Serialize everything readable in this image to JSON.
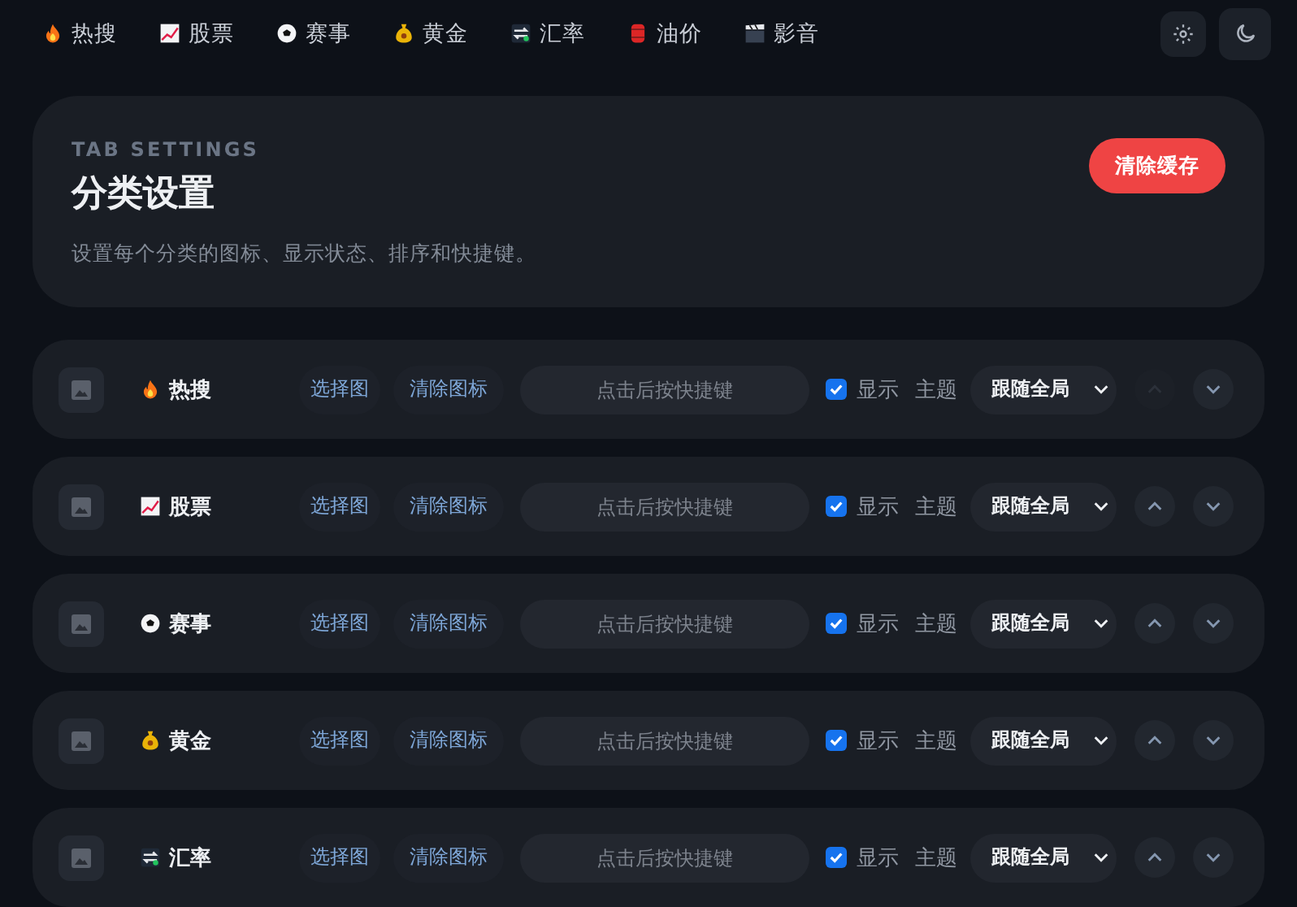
{
  "nav": {
    "tabs": [
      {
        "label": "热搜",
        "kind": "fire"
      },
      {
        "label": "股票",
        "kind": "chart"
      },
      {
        "label": "赛事",
        "kind": "ball"
      },
      {
        "label": "黄金",
        "kind": "money"
      },
      {
        "label": "汇率",
        "kind": "exchange"
      },
      {
        "label": "油价",
        "kind": "barrel"
      },
      {
        "label": "影音",
        "kind": "clapper"
      }
    ]
  },
  "header": {
    "eyebrow": "TAB SETTINGS",
    "title": "分类设置",
    "description": "设置每个分类的图标、显示状态、排序和快捷键。",
    "clear_button": "清除缓存"
  },
  "rows": [
    {
      "label": "热搜",
      "kind": "fire",
      "choose_icon": "选择图",
      "clear_icon": "清除图标",
      "shortcut_placeholder": "点击后按快捷键",
      "show_label": "显示",
      "checked": true,
      "theme_label": "主题",
      "theme_value": "跟随全局",
      "up_disabled": true
    },
    {
      "label": "股票",
      "kind": "chart",
      "choose_icon": "选择图",
      "clear_icon": "清除图标",
      "shortcut_placeholder": "点击后按快捷键",
      "show_label": "显示",
      "checked": true,
      "theme_label": "主题",
      "theme_value": "跟随全局",
      "up_disabled": false
    },
    {
      "label": "赛事",
      "kind": "ball",
      "choose_icon": "选择图",
      "clear_icon": "清除图标",
      "shortcut_placeholder": "点击后按快捷键",
      "show_label": "显示",
      "checked": true,
      "theme_label": "主题",
      "theme_value": "跟随全局",
      "up_disabled": false
    },
    {
      "label": "黄金",
      "kind": "money",
      "choose_icon": "选择图",
      "clear_icon": "清除图标",
      "shortcut_placeholder": "点击后按快捷键",
      "show_label": "显示",
      "checked": true,
      "theme_label": "主题",
      "theme_value": "跟随全局",
      "up_disabled": false
    },
    {
      "label": "汇率",
      "kind": "exchange",
      "choose_icon": "选择图",
      "clear_icon": "清除图标",
      "shortcut_placeholder": "点击后按快捷键",
      "show_label": "显示",
      "checked": true,
      "theme_label": "主题",
      "theme_value": "跟随全局",
      "up_disabled": false
    }
  ]
}
